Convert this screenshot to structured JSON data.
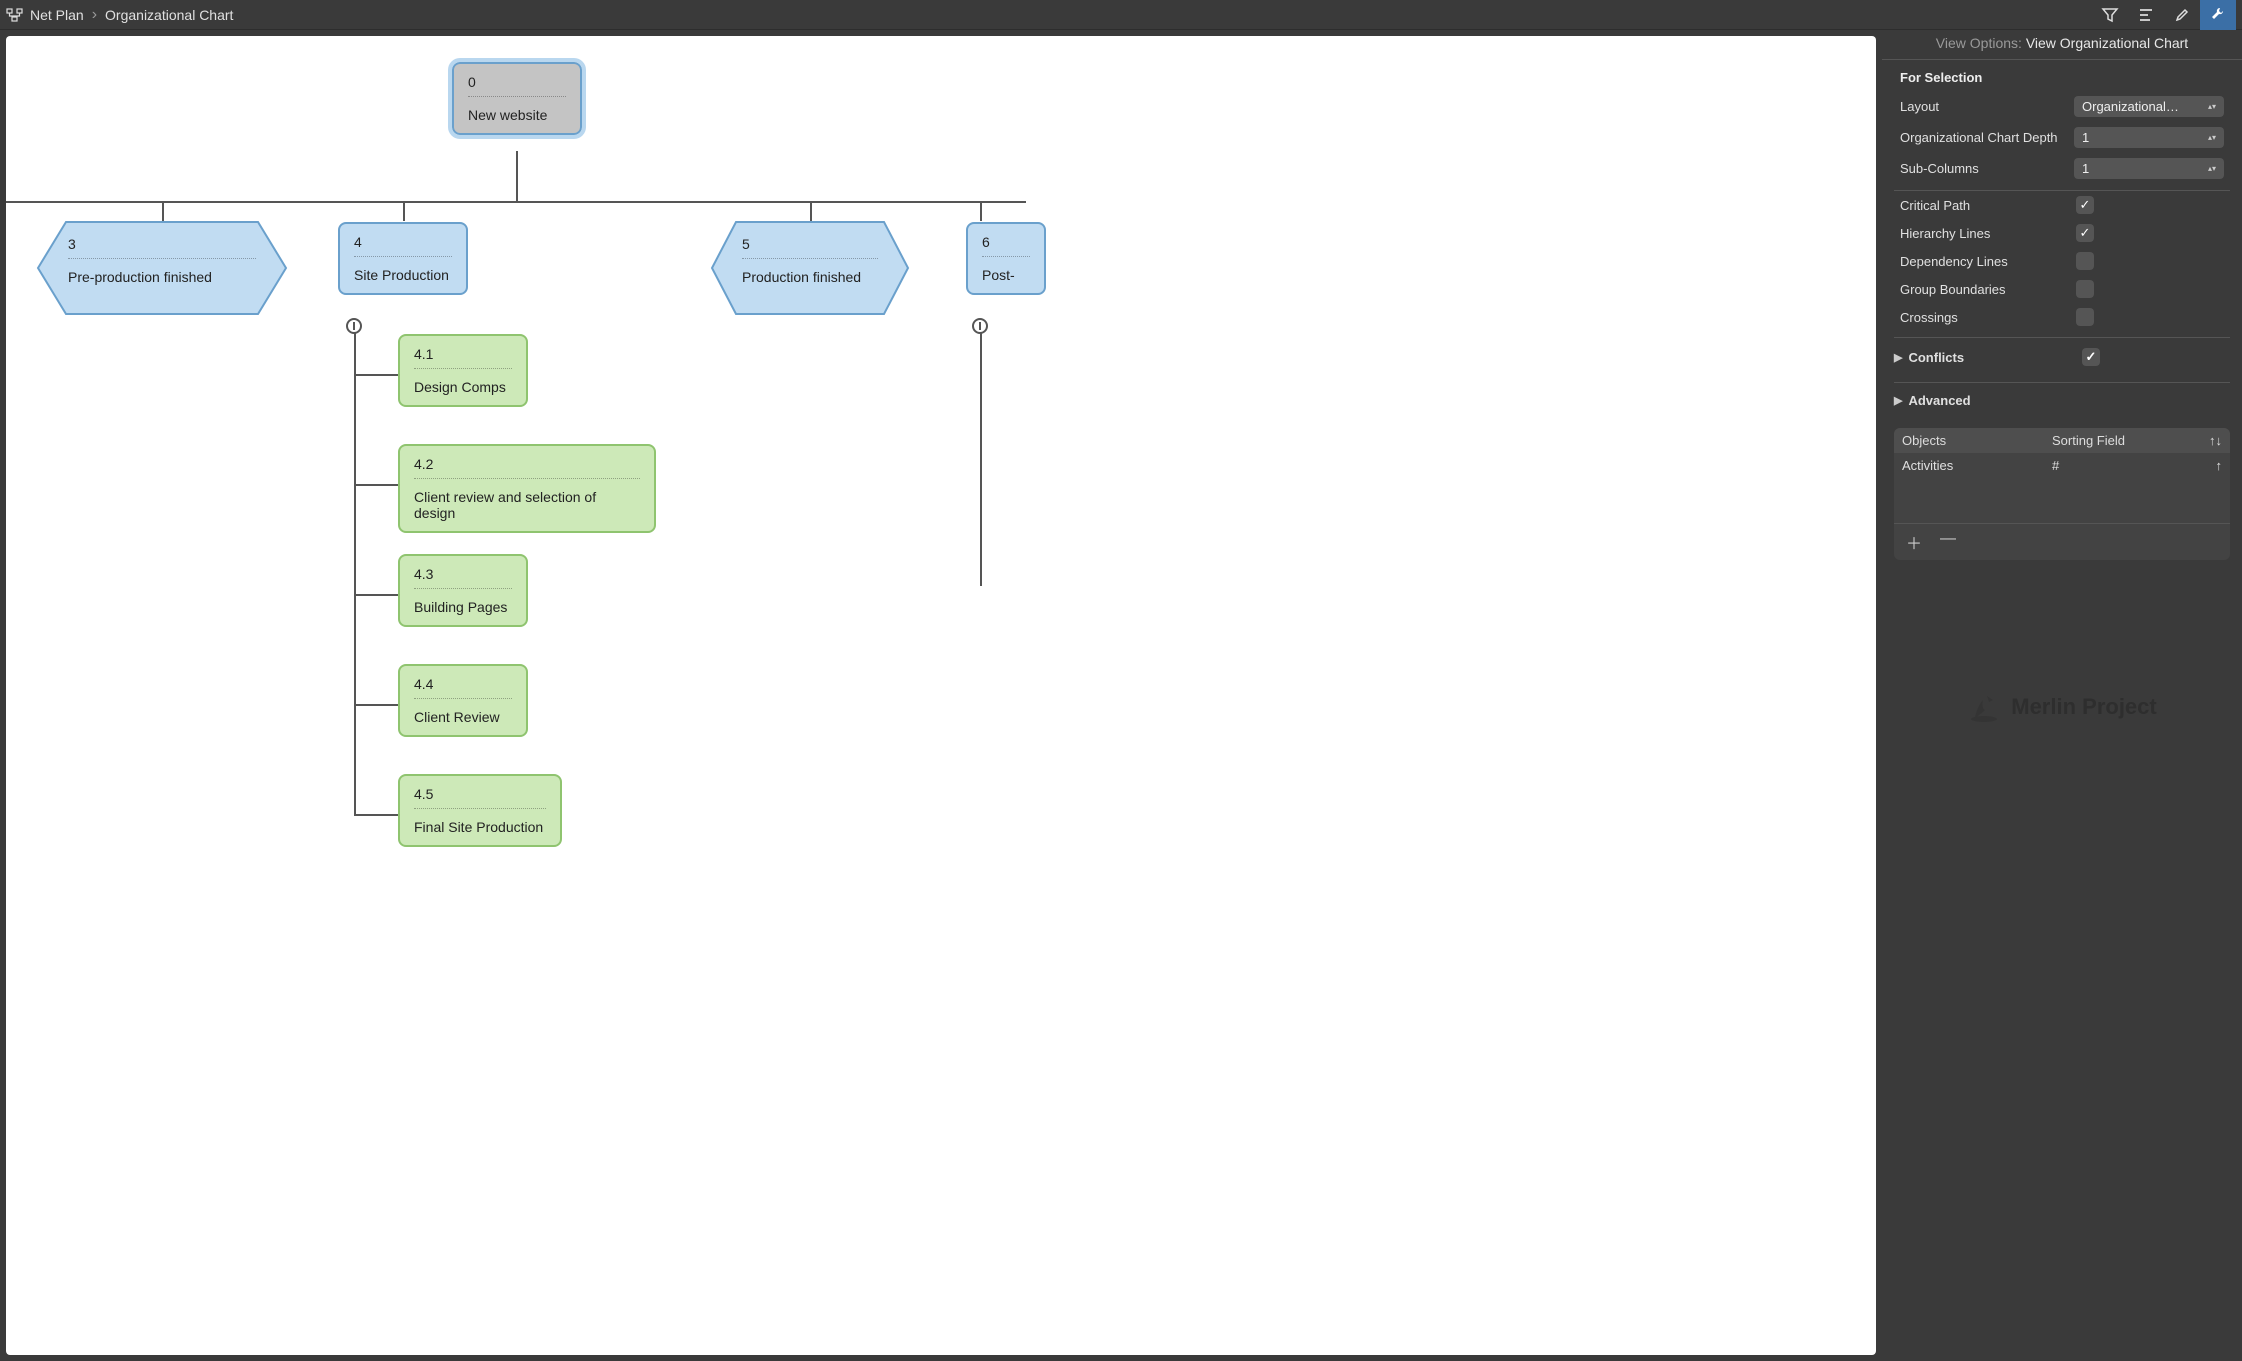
{
  "breadcrumb": {
    "root": "Net Plan",
    "current": "Organizational Chart"
  },
  "inspector": {
    "header_prefix": "View Options:",
    "header_value": "View Organizational Chart",
    "for_selection": "For Selection",
    "layout_label": "Layout",
    "layout_value": "Organizational…",
    "depth_label": "Organizational Chart Depth",
    "depth_value": "1",
    "subcols_label": "Sub-Columns",
    "subcols_value": "1",
    "critical_path": "Critical Path",
    "hierarchy_lines": "Hierarchy Lines",
    "dependency_lines": "Dependency Lines",
    "group_boundaries": "Group Boundaries",
    "crossings": "Crossings",
    "conflicts": "Conflicts",
    "advanced": "Advanced",
    "table": {
      "col_objects": "Objects",
      "col_sorting": "Sorting Field",
      "col_dir": "↑↓",
      "row_objects": "Activities",
      "row_sorting": "#",
      "row_dir": "↑"
    }
  },
  "brand": "Merlin Project",
  "chart_data": {
    "type": "org-chart",
    "root": {
      "id": "0",
      "title": "New website"
    },
    "level1": [
      {
        "id": "3",
        "title": "Pre-production finished",
        "shape": "hex"
      },
      {
        "id": "4",
        "title": "Site Production",
        "shape": "box"
      },
      {
        "id": "5",
        "title": "Production finished",
        "shape": "hex"
      },
      {
        "id": "6",
        "title": "Post-",
        "shape": "box"
      }
    ],
    "children_of_4": [
      {
        "id": "4.1",
        "title": "Design Comps"
      },
      {
        "id": "4.2",
        "title": "Client review and selection of design"
      },
      {
        "id": "4.3",
        "title": "Building Pages"
      },
      {
        "id": "4.4",
        "title": "Client Review"
      },
      {
        "id": "4.5",
        "title": "Final Site Production"
      }
    ]
  }
}
